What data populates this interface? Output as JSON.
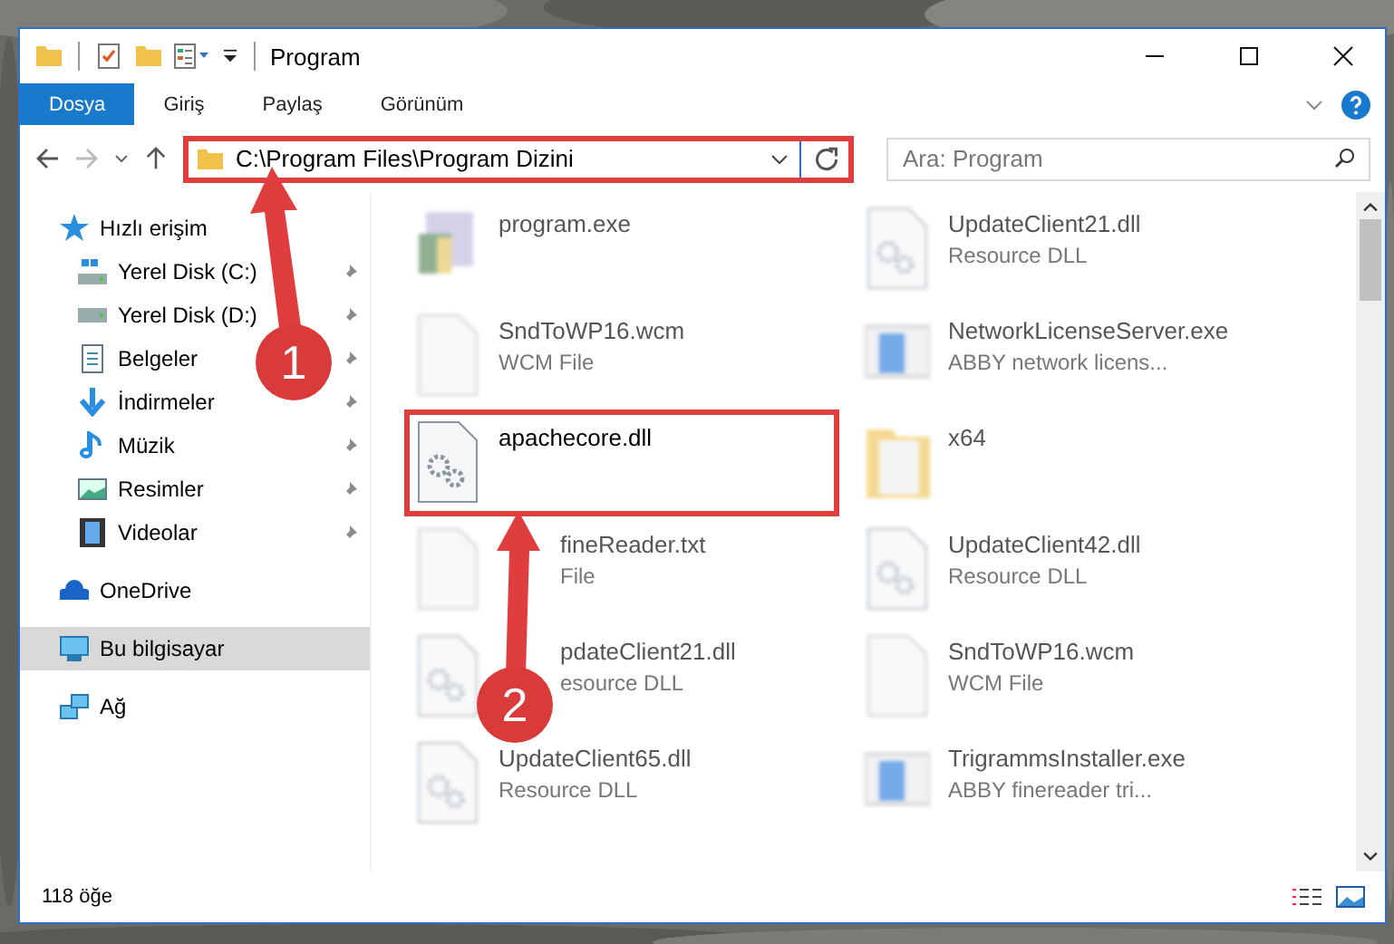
{
  "window": {
    "title": "Program"
  },
  "ribbon_tabs": [
    {
      "label": "Dosya",
      "selected": true
    },
    {
      "label": "Giriş",
      "selected": false
    },
    {
      "label": "Paylaş",
      "selected": false
    },
    {
      "label": "Görünüm",
      "selected": false
    }
  ],
  "address_bar": {
    "path": "C:\\Program Files\\Program Dizini",
    "highlighted": true
  },
  "search": {
    "placeholder": "Ara: Program"
  },
  "sidebar": {
    "items": [
      {
        "label": "Hızlı erişim",
        "kind": "star",
        "selected": false,
        "children": [
          {
            "label": "Yerel Disk (C:)",
            "kind": "drive-win",
            "selected": false,
            "pinned": true
          },
          {
            "label": "Yerel Disk (D:)",
            "kind": "drive",
            "selected": false,
            "pinned": true
          },
          {
            "label": "Belgeler",
            "kind": "docs",
            "selected": false,
            "pinned": true
          },
          {
            "label": "İndirmeler",
            "kind": "download",
            "selected": false,
            "pinned": true
          },
          {
            "label": "Müzik",
            "kind": "music",
            "selected": false,
            "pinned": true
          },
          {
            "label": "Resimler",
            "kind": "pictures",
            "selected": false,
            "pinned": true
          },
          {
            "label": "Videolar",
            "kind": "videos",
            "selected": false,
            "pinned": true
          }
        ]
      },
      {
        "label": "OneDrive",
        "kind": "cloud",
        "selected": false
      },
      {
        "label": "Bu bilgisayar",
        "kind": "pc",
        "selected": true
      },
      {
        "label": "Ağ",
        "kind": "network",
        "selected": false
      }
    ]
  },
  "files": [
    {
      "name": "program.exe",
      "kind": "exe",
      "highlighted": false,
      "blurred": true
    },
    {
      "name": "UpdateClient21.dll",
      "type": "Resource DLL",
      "kind": "gear-doc",
      "highlighted": false,
      "blurred": true
    },
    {
      "name": "SndToWP16.wcm",
      "type": "WCM File",
      "kind": "blank-doc",
      "highlighted": false,
      "blurred": true
    },
    {
      "name": "NetworkLicenseServer.exe",
      "type": "ABBY network licens...",
      "kind": "window-app",
      "highlighted": false,
      "blurred": true
    },
    {
      "name": "apachecore.dll",
      "kind": "gear-doc",
      "highlighted": true,
      "blurred": false
    },
    {
      "name": "x64",
      "kind": "folder",
      "highlighted": false,
      "blurred": true
    },
    {
      "name": "fineReader.txt",
      "type": "File",
      "kind": "blank-doc",
      "highlighted": false,
      "blurred": true,
      "covered": true
    },
    {
      "name": "UpdateClient42.dll",
      "type": "Resource DLL",
      "kind": "gear-doc",
      "highlighted": false,
      "blurred": true
    },
    {
      "name": "pdateClient21.dll",
      "type": "esource DLL",
      "kind": "gear-doc",
      "highlighted": false,
      "blurred": true,
      "covered": true
    },
    {
      "name": "SndToWP16.wcm",
      "type": "WCM File",
      "kind": "blank-doc",
      "highlighted": false,
      "blurred": true
    },
    {
      "name": "UpdateClient65.dll",
      "type": "Resource DLL",
      "kind": "gear-doc",
      "highlighted": false,
      "blurred": true
    },
    {
      "name": "TrigrammsInstaller.exe",
      "type": "ABBY finereader tri...",
      "kind": "window-app",
      "highlighted": false,
      "blurred": true
    }
  ],
  "callouts": [
    {
      "label": "1"
    },
    {
      "label": "2"
    }
  ],
  "status_bar": {
    "item_count": "118 öğe"
  }
}
